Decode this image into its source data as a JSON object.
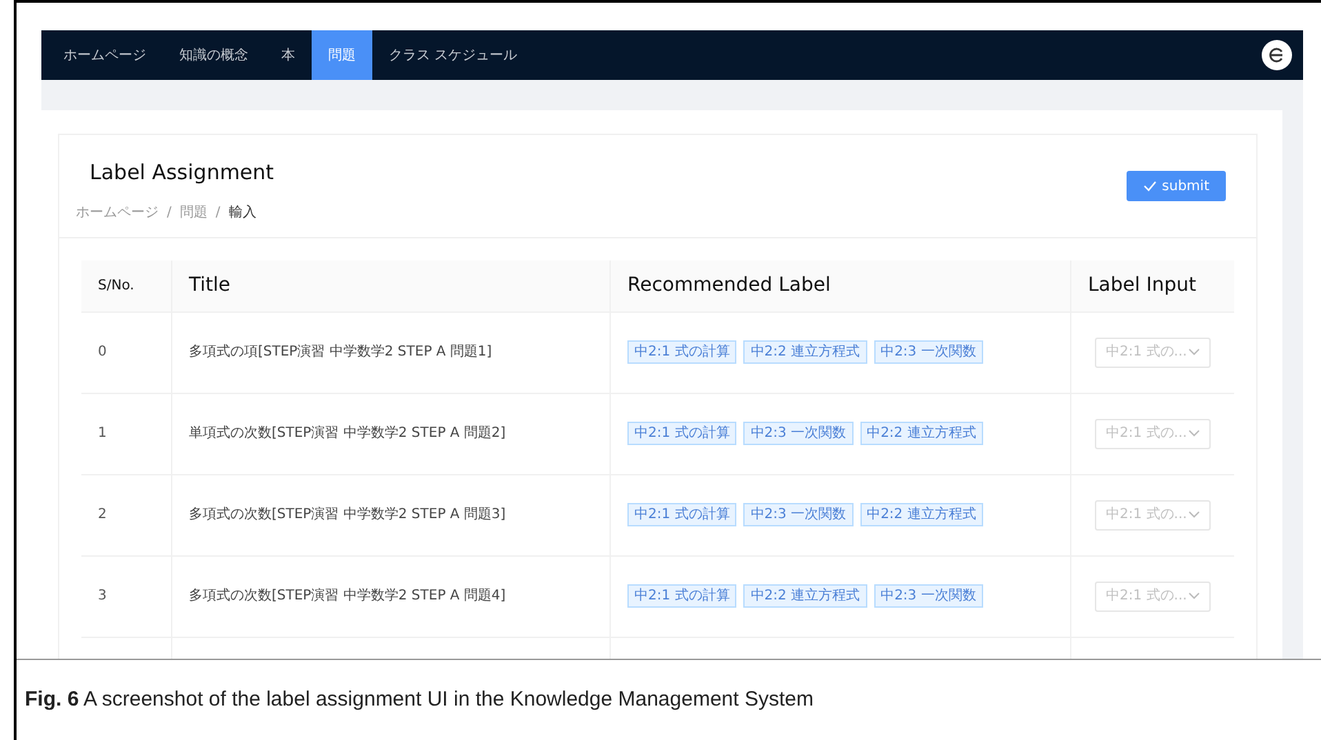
{
  "nav": {
    "items": [
      {
        "label": "ホームページ",
        "selected": false
      },
      {
        "label": "知識の概念",
        "selected": false
      },
      {
        "label": "本",
        "selected": false
      },
      {
        "label": "問題",
        "selected": true
      },
      {
        "label": "クラス スケジュール",
        "selected": false
      }
    ]
  },
  "page": {
    "title": "Label Assignment",
    "breadcrumb": [
      "ホームページ",
      "問題",
      "輸入"
    ],
    "breadcrumb_separators": [
      "/",
      "/"
    ],
    "submit": "submit"
  },
  "table": {
    "columns": [
      "S/No.",
      "Title",
      "Recommended Label",
      "Label Input"
    ],
    "rows": [
      {
        "sno": "0",
        "title": "多項式の項[STEP演習 中学数学2 STEP A 問題1]",
        "labels": [
          "中2:1 式の計算",
          "中2:2 連立方程式",
          "中2:3 一次関数"
        ],
        "input": {
          "placeholder": "中2:1 式の..."
        }
      },
      {
        "sno": "1",
        "title": "単項式の次数[STEP演習 中学数学2 STEP A 問題2]",
        "labels": [
          "中2:1 式の計算",
          "中2:3 一次関数",
          "中2:2 連立方程式"
        ],
        "input": {
          "placeholder": "中2:1 式の..."
        }
      },
      {
        "sno": "2",
        "title": "多項式の次数[STEP演習 中学数学2 STEP A 問題3]",
        "labels": [
          "中2:1 式の計算",
          "中2:3 一次関数",
          "中2:2 連立方程式"
        ],
        "input": {
          "placeholder": "中2:1 式の..."
        }
      },
      {
        "sno": "3",
        "title": "多項式の次数[STEP演習 中学数学2 STEP A 問題4]",
        "labels": [
          "中2:1 式の計算",
          "中2:2 連立方程式",
          "中2:3 一次関数"
        ],
        "input": {
          "placeholder": "中2:1 式の..."
        }
      }
    ]
  },
  "caption": "**Fig. 6** A screenshot of the label assignment UI in the Knowledge Management System"
}
